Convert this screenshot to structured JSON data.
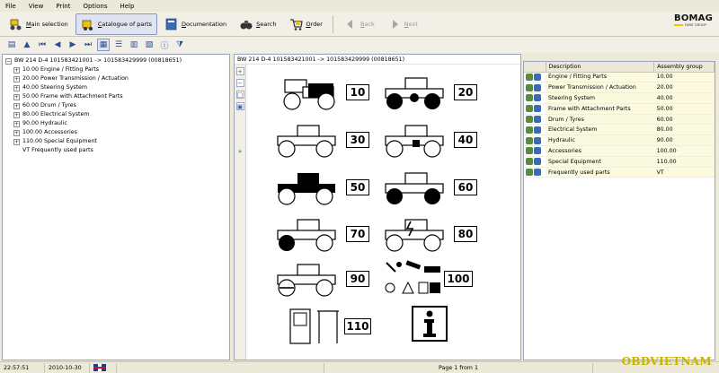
{
  "menu": [
    "File",
    "View",
    "Print",
    "Options",
    "Help"
  ],
  "toolbar": {
    "main_selection": "Main selection",
    "catalogue": "Catalogue of parts",
    "documentation": "Documentation",
    "search": "Search",
    "order": "Order",
    "back": "Back",
    "next": "Next"
  },
  "logo": {
    "word": "BOMAG",
    "sub": "FAYAT GROUP"
  },
  "tree": {
    "root": "BW 214 D-4 101583421001  -> 101583429999 (00818651)",
    "children": [
      "10.00 Engine / Fitting Parts",
      "20.00 Power Transmission / Actuation",
      "40.00 Steering System",
      "50.00 Frame with Attachment Parts",
      "60.00 Drum / Tyres",
      "80.00 Electrical System",
      "90.00 Hydraulic",
      "100.00 Accessories",
      "110.00 Special Equipment"
    ],
    "leaf": "VT  Frequently used parts"
  },
  "middle": {
    "header": "BW 214 D-4 101583421001  -> 101583429999 (00818651)",
    "expand_label": "»",
    "tiles": [
      "10",
      "20",
      "30",
      "40",
      "50",
      "60",
      "70",
      "80",
      "90",
      "100",
      "110"
    ]
  },
  "table": {
    "headers": [
      "Description",
      "Assembly group"
    ],
    "rows": [
      {
        "desc": "Engine / Fitting Parts",
        "group": "10.00"
      },
      {
        "desc": "Power Transmission / Actuation",
        "group": "20.00"
      },
      {
        "desc": "Steering System",
        "group": "40.00"
      },
      {
        "desc": "Frame with Attachment Parts",
        "group": "50.00"
      },
      {
        "desc": "Drum / Tyres",
        "group": "60.00"
      },
      {
        "desc": "Electrical System",
        "group": "80.00"
      },
      {
        "desc": "Hydraulic",
        "group": "90.00"
      },
      {
        "desc": "Accessories",
        "group": "100.00"
      },
      {
        "desc": "Special Equipment",
        "group": "110.00"
      },
      {
        "desc": "Frequently used parts",
        "group": "VT"
      }
    ]
  },
  "status": {
    "time": "22:57:51",
    "date": "2010-10-30",
    "page": "Page 1 from 1"
  },
  "watermark": "OBDVIETNAM",
  "colors": {
    "accent": "#2f4f8f",
    "table_cell": "#fbfadf",
    "watermark": "#c9b200"
  }
}
